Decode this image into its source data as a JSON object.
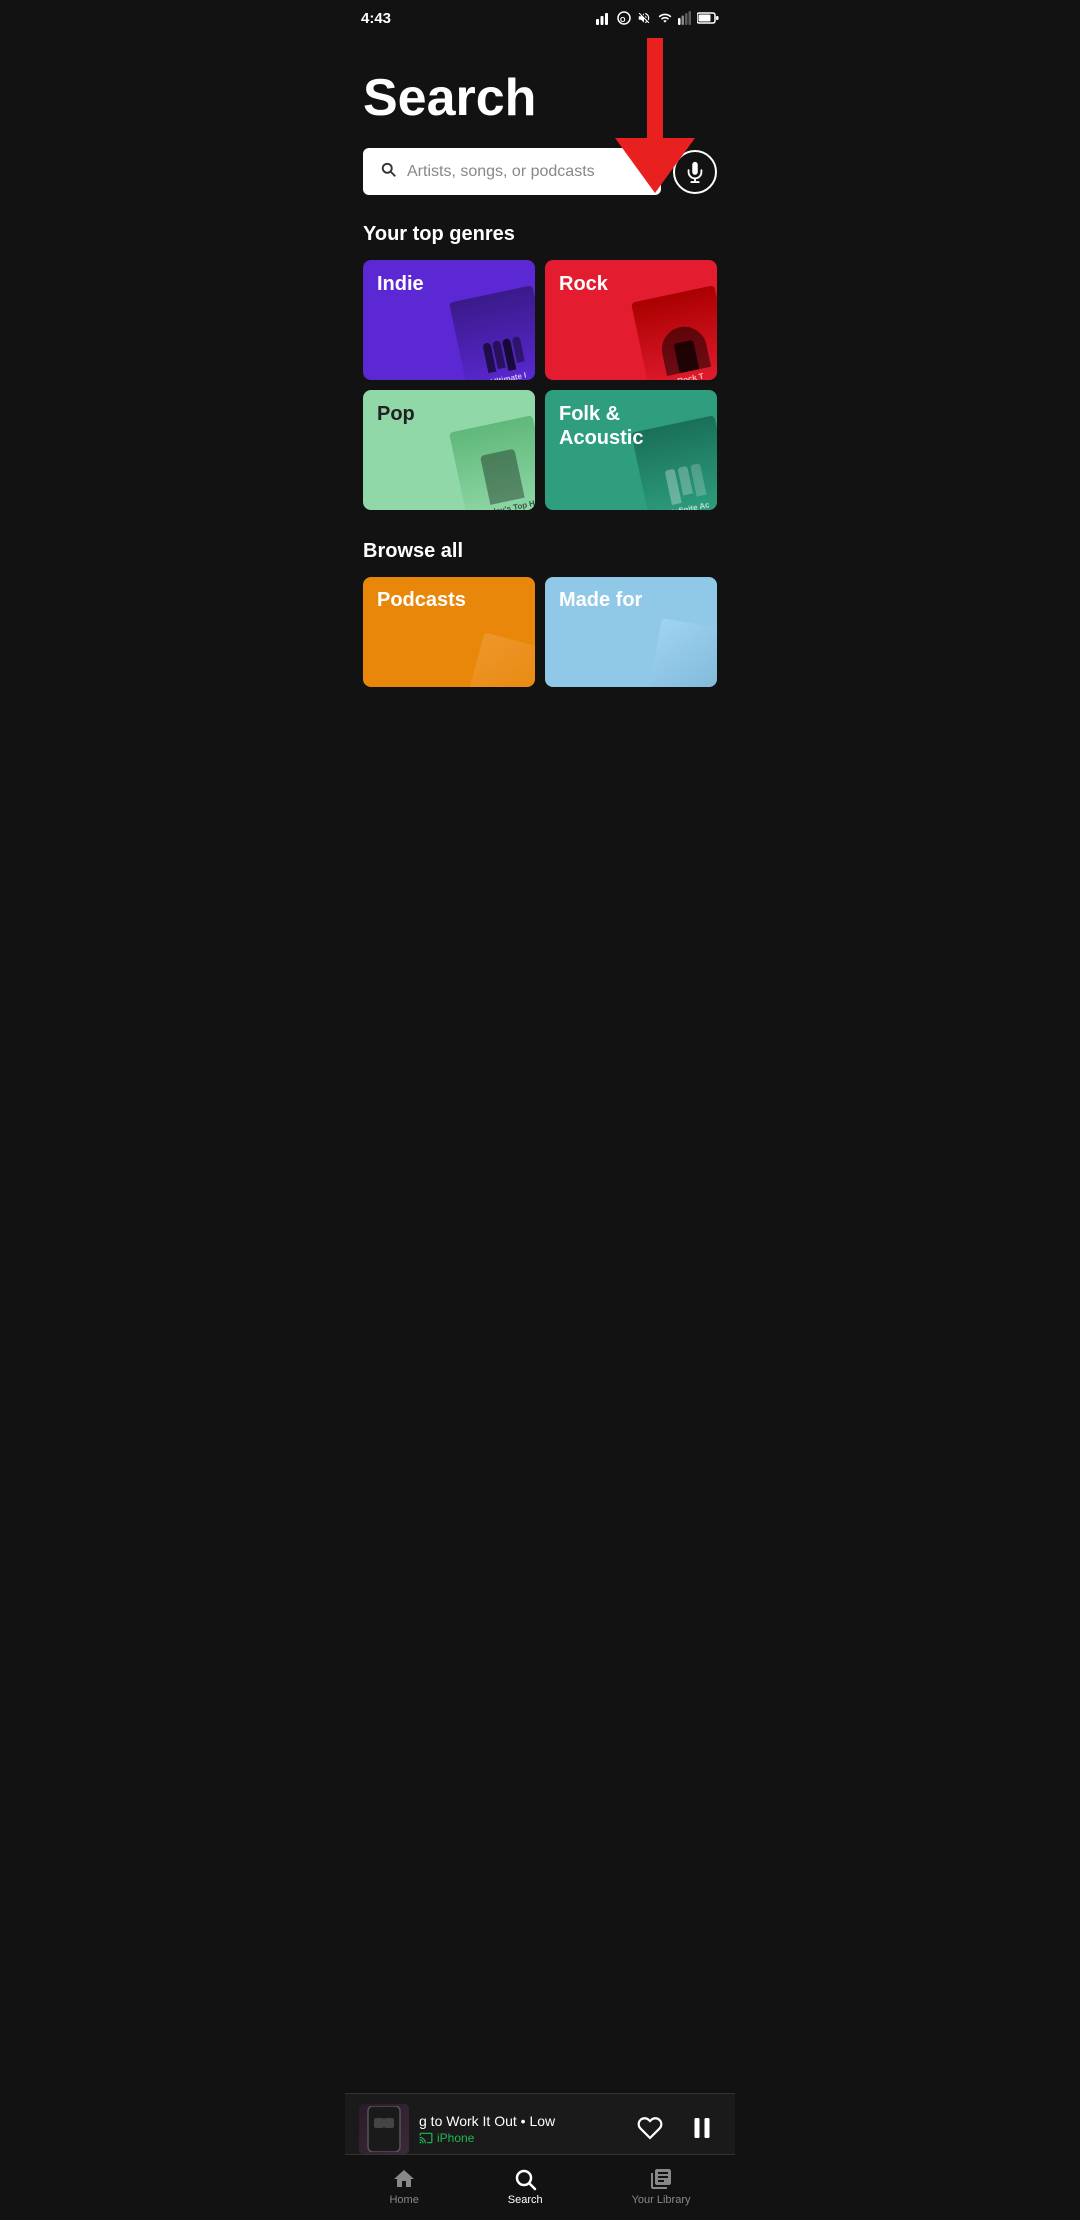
{
  "statusBar": {
    "time": "4:43",
    "icons": [
      "signal",
      "data-icon",
      "mute",
      "wifi",
      "signal2",
      "battery"
    ]
  },
  "page": {
    "title": "Search",
    "searchPlaceholder": "Artists, songs, or podcasts"
  },
  "topGenres": {
    "sectionLabel": "Your top genres",
    "items": [
      {
        "id": "indie",
        "label": "Indie",
        "color": "#5B28D4",
        "sublabel": "Ultimate I"
      },
      {
        "id": "rock",
        "label": "Rock",
        "color": "#E31C2F",
        "sublabel": "Rock T"
      },
      {
        "id": "pop",
        "label": "Pop",
        "color": "#90D8A8",
        "sublabel": "Today's Top H"
      },
      {
        "id": "folk",
        "label": "Folk &\nAcoustic",
        "color": "#2E9E7E",
        "sublabel": "Infinite Ac"
      }
    ]
  },
  "browseAll": {
    "sectionLabel": "Browse all",
    "items": [
      {
        "id": "podcasts",
        "label": "Podcasts",
        "color": "#E8870A"
      },
      {
        "id": "made-for",
        "label": "Made for",
        "color": "#90C8E8"
      }
    ]
  },
  "nowPlaying": {
    "trackName": "g to Work It Out • Low",
    "device": "iPhone",
    "isPlaying": true
  },
  "bottomNav": {
    "items": [
      {
        "id": "home",
        "label": "Home",
        "active": false
      },
      {
        "id": "search",
        "label": "Search",
        "active": true
      },
      {
        "id": "library",
        "label": "Your Library",
        "active": false
      }
    ]
  },
  "colors": {
    "spotify_green": "#1db954",
    "background": "#121212",
    "surface": "#1a1a1a",
    "red_arrow": "#E82020"
  }
}
